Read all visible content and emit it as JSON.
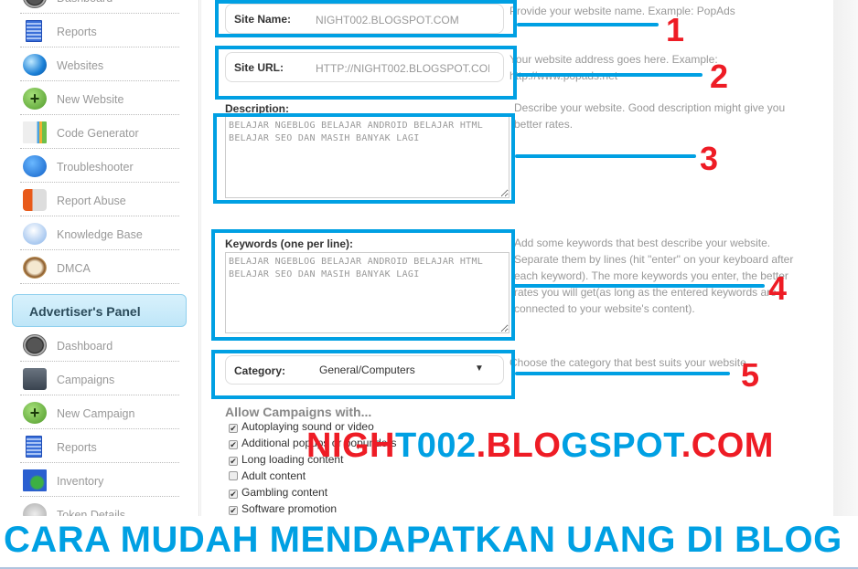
{
  "sidebar": {
    "publisher_items": [
      {
        "label": "Dashboard",
        "icon": "dashboard-icon"
      },
      {
        "label": "Reports",
        "icon": "reports-icon"
      },
      {
        "label": "Websites",
        "icon": "globe-icon"
      },
      {
        "label": "New Website",
        "icon": "plus-icon"
      },
      {
        "label": "Code Generator",
        "icon": "code-generator-icon"
      },
      {
        "label": "Troubleshooter",
        "icon": "first-aid-icon"
      },
      {
        "label": "Report Abuse",
        "icon": "megaphone-icon"
      },
      {
        "label": "Knowledge Base",
        "icon": "lightbulb-icon"
      },
      {
        "label": "DMCA",
        "icon": "seal-icon"
      }
    ],
    "advertiser_panel": "Advertiser's Panel",
    "advertiser_items": [
      {
        "label": "Dashboard",
        "icon": "dashboard-icon"
      },
      {
        "label": "Campaigns",
        "icon": "wallet-icon"
      },
      {
        "label": "New Campaign",
        "icon": "plus-icon"
      },
      {
        "label": "Reports",
        "icon": "reports-icon"
      },
      {
        "label": "Inventory",
        "icon": "inventory-icon"
      },
      {
        "label": "Token Details",
        "icon": "token-icon"
      }
    ]
  },
  "form": {
    "site_name": {
      "label": "Site Name:",
      "value": "NIGHT002.BLOGSPOT.COM",
      "help": "Provide your website name. Example: PopAds"
    },
    "site_url": {
      "label": "Site URL:",
      "value": "HTTP://NIGHT002.BLOGSPOT.COI",
      "help": "Your website address goes here. Example: http://www.popads.net"
    },
    "description": {
      "label": "Description:",
      "value": "BELAJAR NGEBLOG BELAJAR ANDROID BELAJAR HTML BELAJAR SEO DAN MASIH BANYAK LAGI",
      "help": "Describe your website. Good description might give you better rates."
    },
    "keywords": {
      "label": "Keywords (one per line):",
      "value": "BELAJAR NGEBLOG BELAJAR ANDROID BELAJAR HTML BELAJAR SEO DAN MASIH BANYAK LAGI",
      "help": "Add some keywords that best describe your website. Separate them by lines (hit \"enter\" on your keyboard after each keyword). The more keywords you enter, the better rates you will get(as long as the entered keywords are connected to your website's content)."
    },
    "category": {
      "label": "Category:",
      "value": "General/Computers",
      "arrow": "▼",
      "help": "Choose the category that best suits your website."
    },
    "allow_heading": "Allow Campaigns with...",
    "allow_options": [
      {
        "label": "Autoplaying sound or video",
        "checked": true
      },
      {
        "label": "Additional popups or popunders",
        "checked": true
      },
      {
        "label": "Long loading content",
        "checked": true
      },
      {
        "label": "Adult content",
        "checked": false
      },
      {
        "label": "Gambling content",
        "checked": true
      },
      {
        "label": "Software promotion",
        "checked": true
      }
    ]
  },
  "annotations": {
    "numbers": [
      "1",
      "2",
      "3",
      "4",
      "5"
    ],
    "color": "#00a0e3",
    "number_color": "#ee1c25"
  },
  "watermark": {
    "parts": [
      [
        "NIGH",
        "r"
      ],
      [
        "T002",
        "b"
      ],
      [
        ".BLO",
        "r"
      ],
      [
        "GSPOT",
        "b"
      ],
      [
        ".COM",
        "r"
      ]
    ],
    "text": "NIGHT002.BLOGSPOT.COM"
  },
  "banner": {
    "text": "CARA MUDAH MENDAPATKAN UANG DI BLOG"
  }
}
